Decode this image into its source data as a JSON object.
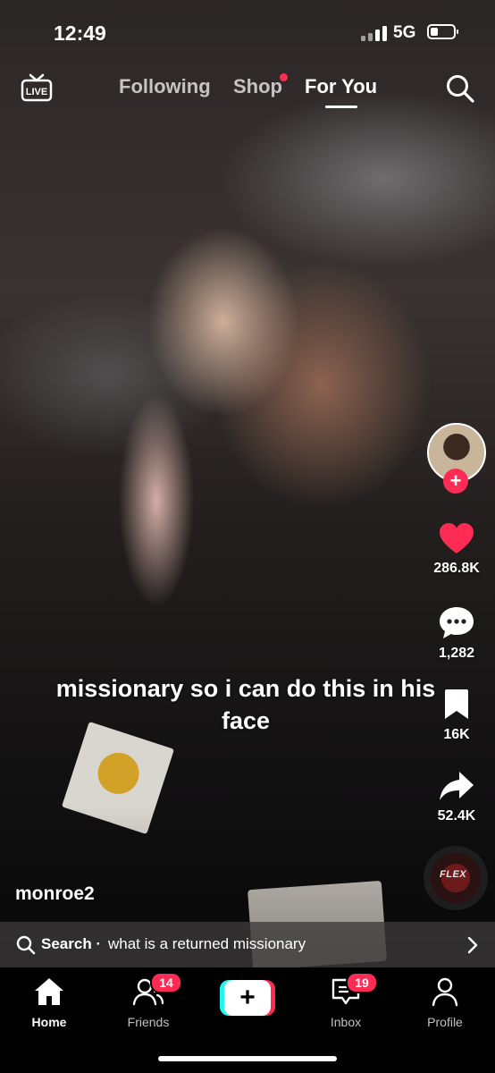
{
  "status_bar": {
    "time": "12:49",
    "network": "5G"
  },
  "top_nav": {
    "live_label": "LIVE",
    "tabs": [
      {
        "label": "Following"
      },
      {
        "label": "Shop"
      },
      {
        "label": "For You"
      }
    ],
    "active_tab": "For You"
  },
  "video": {
    "caption": "missionary so i can do this in his face",
    "username": "monroe2",
    "music_disc_text": "FLEX"
  },
  "actions": {
    "likes": "286.8K",
    "comments": "1,282",
    "saves": "16K",
    "shares": "52.4K"
  },
  "search_suggestion": {
    "prefix": "Search ·",
    "query": "what is a returned missionary"
  },
  "bottom_nav": {
    "items": [
      {
        "label": "Home"
      },
      {
        "label": "Friends",
        "badge": "14"
      },
      {
        "label": ""
      },
      {
        "label": "Inbox",
        "badge": "19"
      },
      {
        "label": "Profile"
      }
    ],
    "active": "Home"
  },
  "colors": {
    "accent": "#fe2c55",
    "cyan": "#25f4ee",
    "background": "#000000"
  }
}
